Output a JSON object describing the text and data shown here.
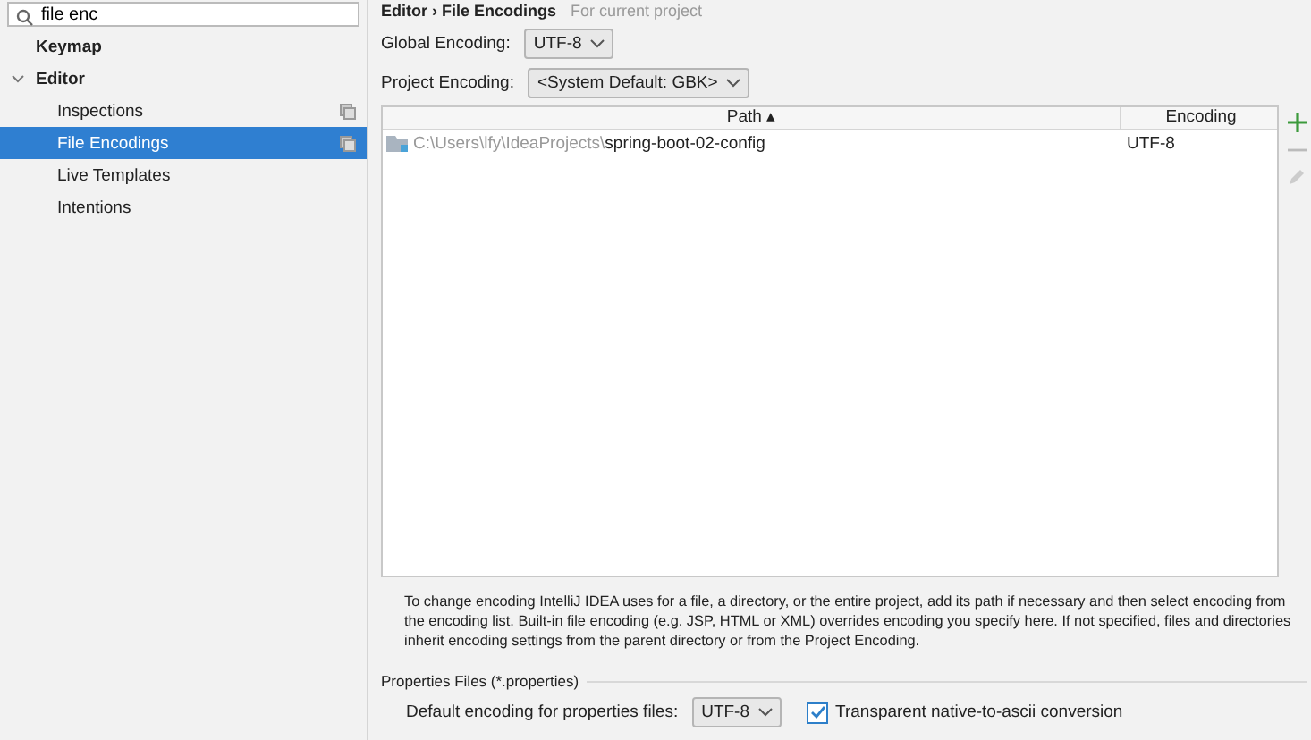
{
  "search": {
    "value": "file enc"
  },
  "sidebar": {
    "items": [
      {
        "label": "Keymap",
        "selected": false,
        "scoped": false
      },
      {
        "label": "Editor",
        "selected": false,
        "scoped": false,
        "expanded": true,
        "children": [
          {
            "label": "Inspections",
            "selected": false,
            "scoped": true
          },
          {
            "label": "File Encodings",
            "selected": true,
            "scoped": true
          },
          {
            "label": "Live Templates",
            "selected": false,
            "scoped": false
          },
          {
            "label": "Intentions",
            "selected": false,
            "scoped": false
          }
        ]
      }
    ]
  },
  "breadcrumb": {
    "path": "Editor › File Encodings",
    "note": "For current project"
  },
  "global_encoding": {
    "label": "Global Encoding:",
    "value": "UTF-8"
  },
  "project_encoding": {
    "label": "Project Encoding:",
    "value": "<System Default: GBK>"
  },
  "table": {
    "columns": [
      "Path ▴",
      "Encoding"
    ],
    "rows": [
      {
        "path_prefix": "C:\\Users\\lfy\\IdeaProjects\\",
        "path_name": "spring-boot-02-config",
        "encoding": "UTF-8"
      }
    ]
  },
  "description": "To change encoding IntelliJ IDEA uses for a file, a directory, or the entire project, add its path if necessary and then select encoding from the encoding list. Built-in file encoding (e.g. JSP, HTML or XML) overrides encoding you specify here. If not specified, files and directories inherit encoding settings from the parent directory or from the Project Encoding.",
  "properties": {
    "title": "Properties Files (*.properties)",
    "label": "Default encoding for properties files:",
    "value": "UTF-8",
    "checkbox": {
      "label": "Transparent native-to-ascii conversion",
      "checked": true
    }
  }
}
